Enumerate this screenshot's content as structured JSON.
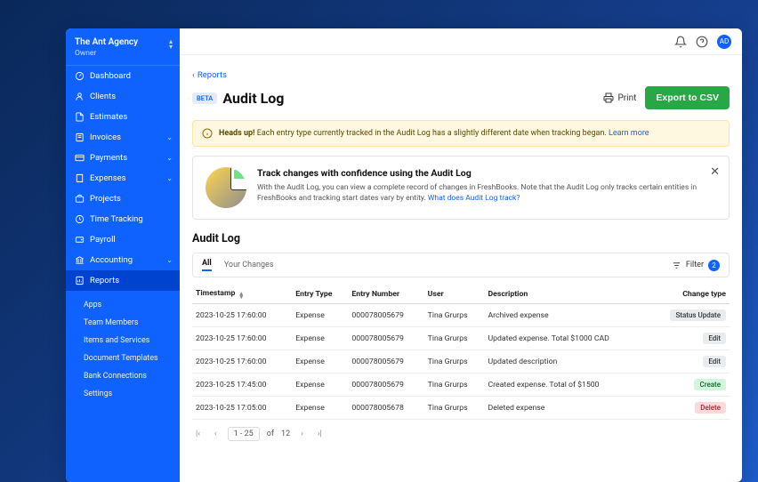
{
  "org": {
    "name": "The Ant Agency",
    "role": "Owner"
  },
  "nav": {
    "items": [
      {
        "label": "Dashboard",
        "icon": "gauge"
      },
      {
        "label": "Clients",
        "icon": "user"
      },
      {
        "label": "Estimates",
        "icon": "file"
      },
      {
        "label": "Invoices",
        "icon": "invoice",
        "expandable": true
      },
      {
        "label": "Payments",
        "icon": "card",
        "expandable": true
      },
      {
        "label": "Expenses",
        "icon": "receipt",
        "expandable": true
      },
      {
        "label": "Projects",
        "icon": "briefcase"
      },
      {
        "label": "Time Tracking",
        "icon": "clock"
      },
      {
        "label": "Payroll",
        "icon": "wallet"
      },
      {
        "label": "Accounting",
        "icon": "bank",
        "expandable": true
      },
      {
        "label": "Reports",
        "icon": "report",
        "active": true
      }
    ],
    "subs": [
      {
        "label": "Apps"
      },
      {
        "label": "Team Members"
      },
      {
        "label": "Items and Services"
      },
      {
        "label": "Document Templates"
      },
      {
        "label": "Bank Connections"
      },
      {
        "label": "Settings"
      }
    ]
  },
  "topbar": {
    "avatar_initials": "AD"
  },
  "breadcrumb": {
    "label": "Reports"
  },
  "page": {
    "beta_label": "BETA",
    "title": "Audit Log",
    "print_label": "Print",
    "export_label": "Export to CSV"
  },
  "alert": {
    "bold": "Heads up!",
    "text": " Each entry type currently tracked in the Audit Log has a slightly different date when tracking began. ",
    "link": "Learn more"
  },
  "info_card": {
    "title": "Track changes with confidence using the Audit Log",
    "desc": "With the Audit Log, you can view a complete record of changes in FreshBooks. Note that the Audit Log only tracks certain entities in FreshBooks and tracking start dates vary by entity. ",
    "link": "What does Audit Log track?"
  },
  "section": {
    "title": "Audit Log"
  },
  "tabs": {
    "all": "All",
    "your_changes": "Your Changes",
    "filter_label": "Filter",
    "filter_count": "2"
  },
  "table": {
    "headers": {
      "timestamp": "Timestamp",
      "entry_type": "Entry Type",
      "entry_number": "Entry Number",
      "user": "User",
      "description": "Description",
      "change_type": "Change type"
    },
    "rows": [
      {
        "ts": "2023-10-25 17:60:00",
        "type": "Expense",
        "num": "000078005679",
        "user": "Tina Grurps",
        "desc": "Archived expense",
        "tag": "Status Update",
        "tag_class": "status-update"
      },
      {
        "ts": "2023-10-25 17:60:00",
        "type": "Expense",
        "num": "000078005679",
        "user": "Tina Grurps",
        "desc": "Updated expense. Total $1000 CAD",
        "tag": "Edit",
        "tag_class": "edit"
      },
      {
        "ts": "2023-10-25 17:60:00",
        "type": "Expense",
        "num": "000078005679",
        "user": "Tina Grurps",
        "desc": "Updated description",
        "tag": "Edit",
        "tag_class": "edit"
      },
      {
        "ts": "2023-10-25 17:45:00",
        "type": "Expense",
        "num": "000078005679",
        "user": "Tina Grurps",
        "desc": "Created expense. Total of $1500",
        "tag": "Create",
        "tag_class": "create"
      },
      {
        "ts": "2023-10-25 17:05:00",
        "type": "Expense",
        "num": "000078005678",
        "user": "Tina Grurps",
        "desc": "Deleted expense",
        "tag": "Delete",
        "tag_class": "delete"
      }
    ]
  },
  "pagination": {
    "range": "1 - 25",
    "of_label": "of",
    "total": "12"
  }
}
